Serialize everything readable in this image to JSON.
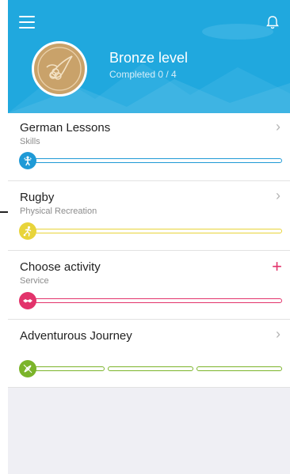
{
  "header": {
    "level_title": "Bronze level",
    "level_subtitle": "Completed 0 / 4",
    "colors": {
      "background": "#20a8de",
      "badge": "#c9a26a"
    }
  },
  "sections": [
    {
      "title": "German Lessons",
      "subtitle": "Skills",
      "action": "chevron",
      "color": "#1f9ad6",
      "icon": "skills-person-icon",
      "progress": 0
    },
    {
      "title": "Rugby",
      "subtitle": "Physical Recreation",
      "action": "chevron",
      "color": "#e8d43a",
      "icon": "running-person-icon",
      "progress": 0
    },
    {
      "title": "Choose activity",
      "subtitle": "Service",
      "action": "plus",
      "color": "#e2336b",
      "icon": "handshake-icon",
      "progress": 0
    },
    {
      "title": "Adventurous Journey",
      "subtitle": "",
      "action": "chevron",
      "color": "#7bb42a",
      "icon": "compass-icon",
      "progress": 0
    }
  ],
  "icons": {
    "chevron": "›",
    "plus": "+"
  }
}
